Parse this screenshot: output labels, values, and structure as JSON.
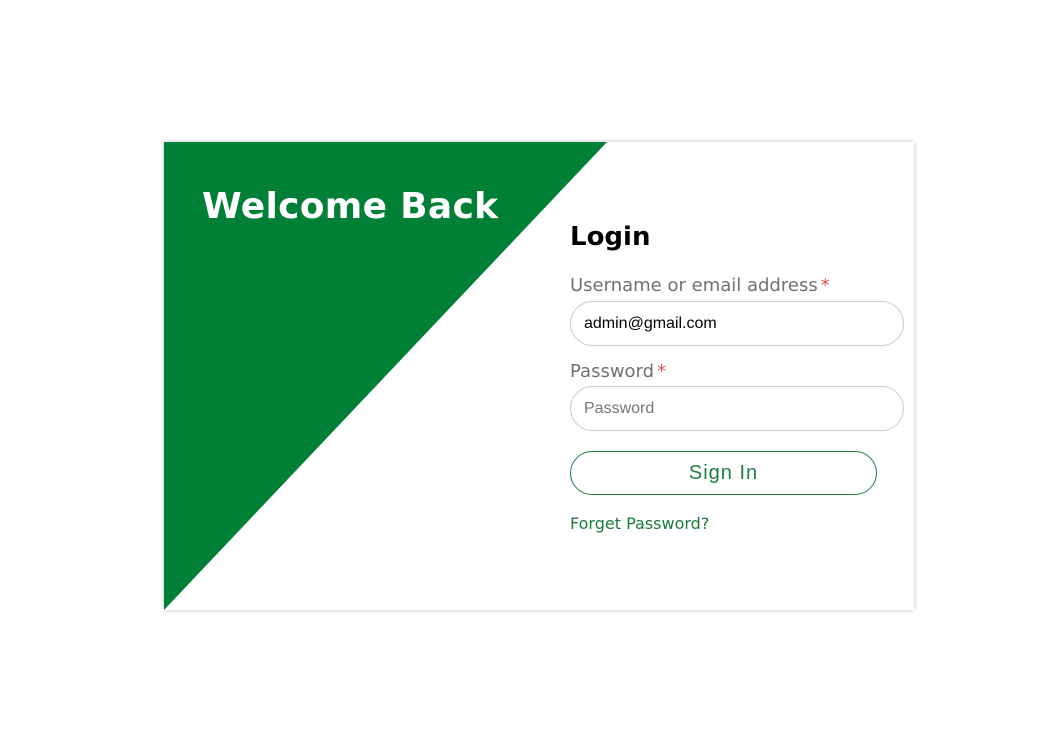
{
  "colors": {
    "brand_green": "#008037",
    "required_asterisk": "#e05555",
    "button_border": "#1f7f3f"
  },
  "banner": {
    "welcome_text": "Welcome Back"
  },
  "login": {
    "title": "Login",
    "username": {
      "label": "Username or email address",
      "required_mark": "*",
      "value": "admin@gmail.com",
      "placeholder": ""
    },
    "password": {
      "label": "Password",
      "required_mark": "*",
      "value": "",
      "placeholder": "Password"
    },
    "sign_in_label": "Sign In",
    "forget_password_label": "Forget Password?"
  }
}
